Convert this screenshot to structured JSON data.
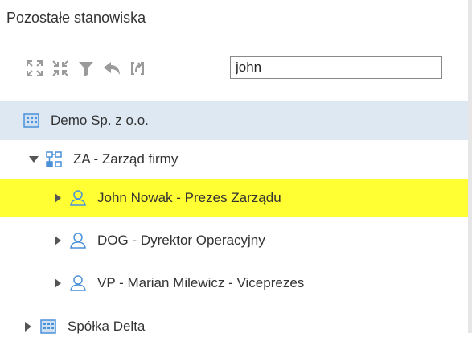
{
  "panel": {
    "title": "Pozostałe stanowiska"
  },
  "toolbar": {
    "buttons": [
      {
        "name": "expand-all-icon"
      },
      {
        "name": "collapse-all-icon"
      },
      {
        "name": "filter-icon"
      },
      {
        "name": "undo-icon"
      },
      {
        "name": "refresh-icon"
      }
    ],
    "search_value": "john"
  },
  "tree": {
    "items": [
      {
        "label": "Demo Sp. z o.o.",
        "type": "company",
        "selected": true
      },
      {
        "label": "ZA - Zarząd firmy",
        "type": "department",
        "expanded": true
      },
      {
        "label": "John Nowak - Prezes Zarządu",
        "type": "person",
        "highlighted": true
      },
      {
        "label": "DOG - Dyrektor Operacyjny",
        "type": "person"
      },
      {
        "label": "VP - Marian Milewicz - Viceprezes",
        "type": "person"
      },
      {
        "label": "Spółka Delta",
        "type": "company"
      }
    ]
  },
  "colors": {
    "icon_blue": "#4a90d9",
    "icon_gray": "#9a9a9a",
    "selected_bg": "#dde8f3",
    "highlight_bg": "#ffff33"
  }
}
